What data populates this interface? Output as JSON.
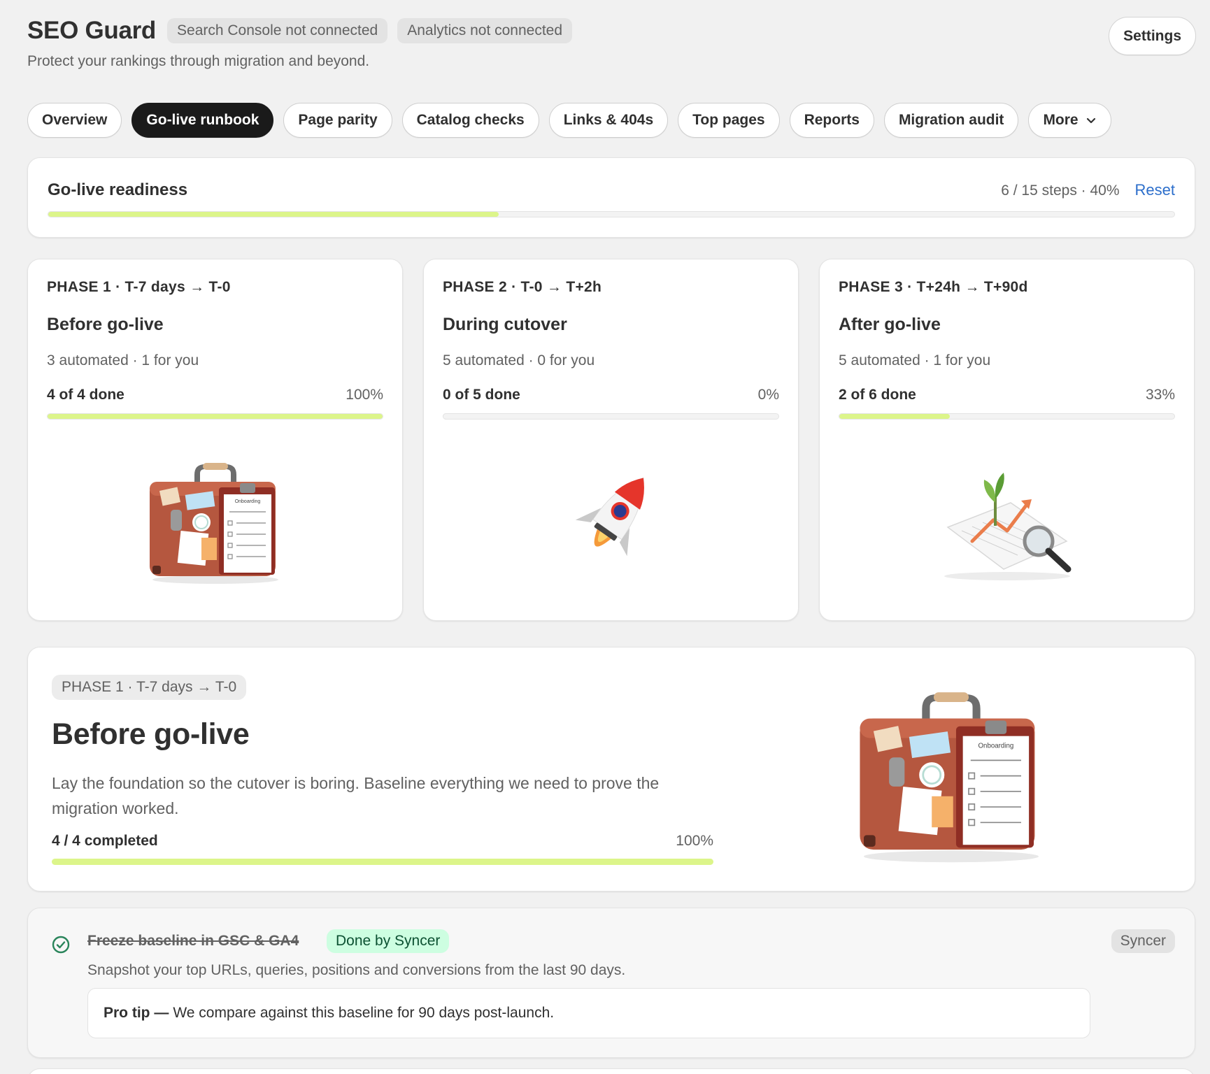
{
  "header": {
    "app_title": "SEO Guard",
    "chips": [
      "Search Console not connected",
      "Analytics not connected"
    ],
    "subtitle": "Protect your rankings through migration and beyond.",
    "settings_label": "Settings"
  },
  "tabs": [
    {
      "label": "Overview",
      "active": false
    },
    {
      "label": "Go-live runbook",
      "active": true
    },
    {
      "label": "Page parity",
      "active": false
    },
    {
      "label": "Catalog checks",
      "active": false
    },
    {
      "label": "Links & 404s",
      "active": false
    },
    {
      "label": "Top pages",
      "active": false
    },
    {
      "label": "Reports",
      "active": false
    },
    {
      "label": "Migration audit",
      "active": false
    },
    {
      "label": "More",
      "active": false
    }
  ],
  "readiness": {
    "title": "Go-live readiness",
    "stats": "6 / 15 steps · 40%",
    "reset_label": "Reset",
    "progress": 0.4
  },
  "phases": [
    {
      "eyebrow": "PHASE 1 · T-7 days → T-0",
      "title": "Before go-live",
      "meta": "3 automated · 1 for you",
      "done": "4 of 4 done",
      "pct": "100%",
      "progress": 1.0,
      "illustration": "suitcase-illustration"
    },
    {
      "eyebrow": "PHASE 2 · T-0 → T+2h",
      "title": "During cutover",
      "meta": "5 automated · 0 for you",
      "done": "0 of 5 done",
      "pct": "0%",
      "progress": 0.0,
      "illustration": "rocket-illustration"
    },
    {
      "eyebrow": "PHASE 3 · T+24h → T+90d",
      "title": "After go-live",
      "meta": "5 automated · 1 for you",
      "done": "2 of 6 done",
      "pct": "33%",
      "progress": 0.33,
      "illustration": "growth-chart-illustration"
    }
  ],
  "detail": {
    "pill": "PHASE 1 · T-7 days → T-0",
    "title": "Before go-live",
    "description": "Lay the foundation so the cutover is boring. Baseline everything we need to prove the migration worked.",
    "done": "4 / 4 completed",
    "pct": "100%",
    "progress": 1.0,
    "illustration_label": "Onboarding"
  },
  "task": {
    "title": "Freeze baseline in GSC & GA4",
    "badge": "Done by Syncer",
    "owner": "Syncer",
    "description": "Snapshot your top URLs, queries, positions and conversions from the last 90 days.",
    "tip_label": "Pro tip —",
    "tip_text": "We compare against this baseline for 90 days post-launch."
  },
  "colors": {
    "progress_fill": "#dcf58a",
    "link": "#2c6ecb",
    "success_badge_bg": "#cdfee1",
    "success_check": "#29845a"
  }
}
